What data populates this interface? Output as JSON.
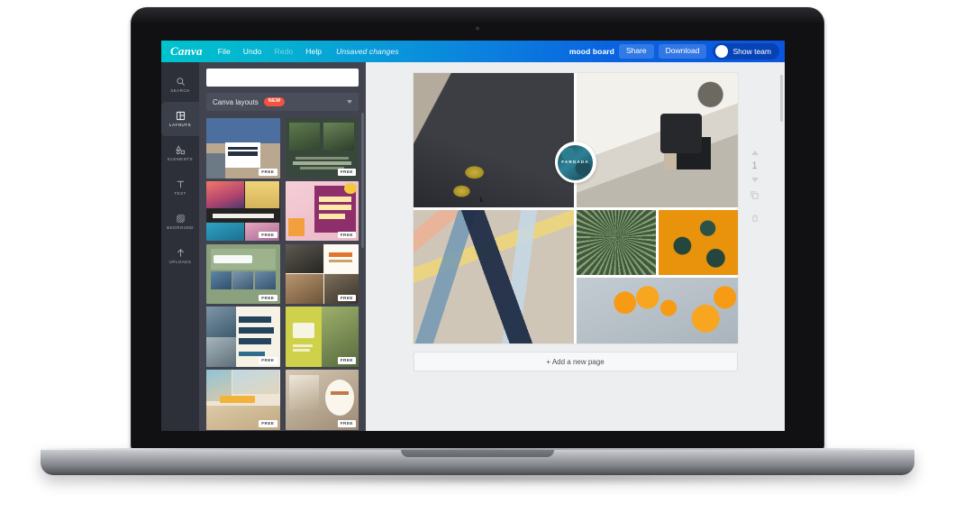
{
  "app": {
    "brand": "Canva",
    "menu": [
      {
        "label": "File",
        "state": "enabled"
      },
      {
        "label": "Undo",
        "state": "enabled"
      },
      {
        "label": "Redo",
        "state": "disabled"
      },
      {
        "label": "Help",
        "state": "enabled"
      }
    ],
    "save_status": "Unsaved changes",
    "document_title": "mood board",
    "share_label": "Share",
    "download_label": "Download",
    "show_team_label": "Show team"
  },
  "colors": {
    "brand_cyan": "#00c2cc",
    "brand_blue": "#0b55dd",
    "rail_bg": "#2d3039",
    "panel_bg": "#41444f",
    "workspace_bg": "#eceef0",
    "new_badge": "#f2543d",
    "accent_orange": "#e8930b"
  },
  "rail": {
    "items": [
      {
        "label": "SEARCH",
        "icon": "search-icon",
        "active": false
      },
      {
        "label": "LAYOUTS",
        "icon": "layouts-icon",
        "active": true
      },
      {
        "label": "ELEMENTS",
        "icon": "elements-icon",
        "active": false
      },
      {
        "label": "TEXT",
        "icon": "text-icon",
        "active": false
      },
      {
        "label": "BKGROUND",
        "icon": "background-icon",
        "active": false
      },
      {
        "label": "UPLOADS",
        "icon": "uploads-icon",
        "active": false
      }
    ]
  },
  "panel": {
    "search_placeholder": "",
    "search_value": "",
    "filter_label": "Canva layouts",
    "filter_badge": "NEW",
    "badge_free": "FREE",
    "thumbnails": [
      {
        "name": "school-university-layout",
        "badge": "FREE",
        "style": "th-school"
      },
      {
        "name": "nature-canyon-layout",
        "badge": "FREE",
        "style": "th-nature"
      },
      {
        "name": "the-color-project-layout",
        "badge": "FREE",
        "style": "th-color-project"
      },
      {
        "name": "daniels-ice-cream-party-layout",
        "badge": "FREE",
        "style": "th-icecream"
      },
      {
        "name": "miss-you-layout",
        "badge": "FREE",
        "style": "th-missyou"
      },
      {
        "name": "grannys-recipes-layout",
        "badge": "FREE",
        "style": "th-recipes"
      },
      {
        "name": "happy-birthday-katelyn-layout",
        "badge": "FREE",
        "style": "th-birthday"
      },
      {
        "name": "twenty-first-layout",
        "badge": "FREE",
        "style": "th-21st"
      },
      {
        "name": "beach-layout",
        "badge": "FREE",
        "style": "th-beach"
      },
      {
        "name": "script-card-layout",
        "badge": "FREE",
        "style": "th-script"
      }
    ]
  },
  "workspace": {
    "page_number": "1",
    "add_page_label": "+ Add a new page",
    "logo_text": "FARGADA",
    "cells": [
      {
        "name": "photo-dark-utensils-lemons",
        "style": "ph-utensils"
      },
      {
        "name": "photo-coffee-mug-window",
        "style": "ph-coffee"
      },
      {
        "name": "photo-color-swatch-sticks",
        "style": "ph-sticks"
      },
      {
        "name": "photo-green-agave-plant",
        "style": "ph-agave"
      },
      {
        "name": "photo-succulents-orange-bg",
        "style": "ph-succulent-orange"
      },
      {
        "name": "photo-oranges-on-concrete",
        "style": "ph-oranges"
      }
    ]
  }
}
